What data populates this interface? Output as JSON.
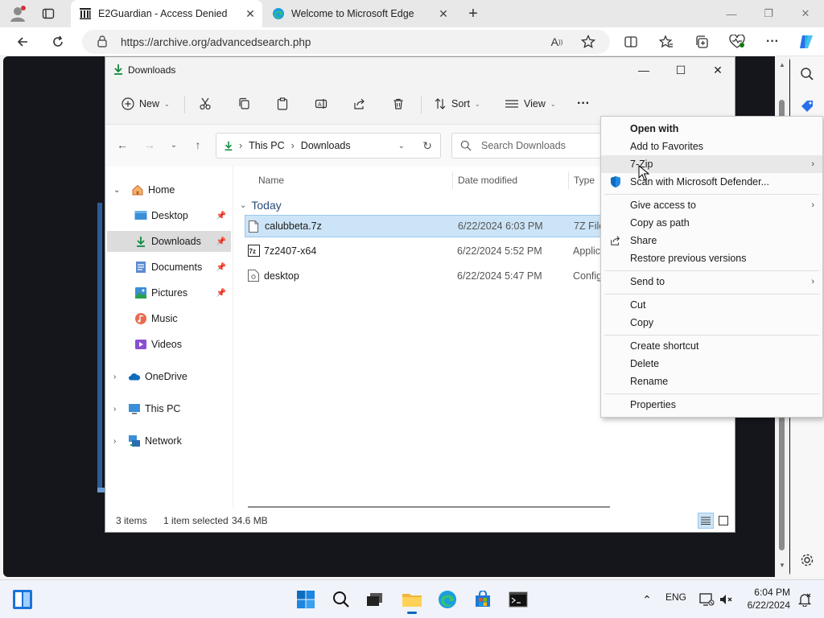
{
  "browser": {
    "tabs": [
      {
        "title": "E2Guardian - Access Denied",
        "favicon": "archive-building-icon",
        "active": true
      },
      {
        "title": "Welcome to Microsoft Edge",
        "favicon": "edge-logo-icon",
        "active": false
      }
    ],
    "new_tab_label": "+",
    "url": "https://archive.org/advancedsearch.php"
  },
  "explorer": {
    "title": "Downloads",
    "toolbar": {
      "new_label": "New",
      "sort_label": "Sort",
      "view_label": "View",
      "more_label": "···"
    },
    "breadcrumb": [
      "This PC",
      "Downloads"
    ],
    "search_placeholder": "Search Downloads",
    "nav": [
      {
        "label": "Home",
        "icon": "home-icon",
        "expandable": true,
        "expanded": true
      },
      {
        "label": "Desktop",
        "icon": "desktop-icon",
        "pinned": true
      },
      {
        "label": "Downloads",
        "icon": "download-icon",
        "pinned": true,
        "selected": true
      },
      {
        "label": "Documents",
        "icon": "documents-icon",
        "pinned": true
      },
      {
        "label": "Pictures",
        "icon": "pictures-icon",
        "pinned": true
      },
      {
        "label": "Music",
        "icon": "music-icon"
      },
      {
        "label": "Videos",
        "icon": "videos-icon"
      },
      {
        "label": "OneDrive",
        "icon": "onedrive-icon",
        "expandable": true
      },
      {
        "label": "This PC",
        "icon": "this-pc-icon",
        "expandable": true
      },
      {
        "label": "Network",
        "icon": "network-icon",
        "expandable": true
      }
    ],
    "columns": {
      "name": "Name",
      "date": "Date modified",
      "type": "Type"
    },
    "group_label": "Today",
    "files": [
      {
        "name": "calubbeta.7z",
        "date": "6/22/2024 6:03 PM",
        "type": "7Z File",
        "selected": true
      },
      {
        "name": "7z2407-x64",
        "date": "6/22/2024 5:52 PM",
        "type": "Applic"
      },
      {
        "name": "desktop",
        "date": "6/22/2024 5:47 PM",
        "type": "Config"
      }
    ],
    "status": {
      "count": "3 items",
      "selected": "1 item selected",
      "size": "34.6 MB"
    }
  },
  "context_menu": {
    "groups": [
      [
        {
          "label": "Open with",
          "bold": true
        },
        {
          "label": "Add to Favorites"
        },
        {
          "label": "7-Zip",
          "submenu": true,
          "hover": true
        },
        {
          "label": "Scan with Microsoft Defender...",
          "icon": "defender-shield-icon"
        }
      ],
      [
        {
          "label": "Give access to",
          "submenu": true
        },
        {
          "label": "Copy as path"
        },
        {
          "label": "Share",
          "icon": "share-icon"
        },
        {
          "label": "Restore previous versions"
        }
      ],
      [
        {
          "label": "Send to",
          "submenu": true
        }
      ],
      [
        {
          "label": "Cut"
        },
        {
          "label": "Copy"
        }
      ],
      [
        {
          "label": "Create shortcut"
        },
        {
          "label": "Delete"
        },
        {
          "label": "Rename"
        }
      ],
      [
        {
          "label": "Properties"
        }
      ]
    ]
  },
  "taskbar": {
    "language": "ENG",
    "time": "6:04 PM",
    "date": "6/22/2024"
  },
  "colors": {
    "accent": "#0067c0",
    "selection": "#cce4f7",
    "tab_bg": "#e8e8e8"
  }
}
